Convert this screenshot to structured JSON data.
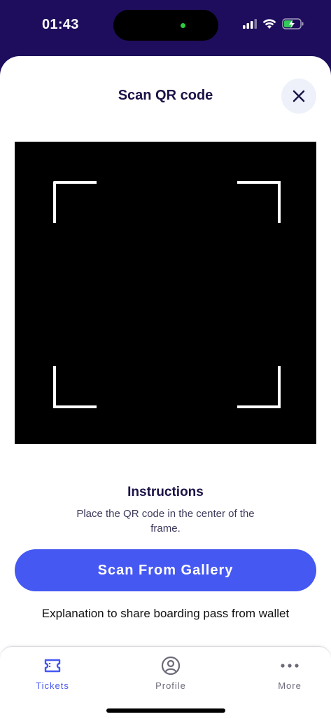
{
  "status_bar": {
    "time": "01:43",
    "icons": [
      "signal-icon",
      "wifi-icon",
      "battery-charging-icon"
    ]
  },
  "header": {
    "title": "Scan QR code",
    "close_icon": "close-icon"
  },
  "scanner": {
    "frame_icon": "scan-frame"
  },
  "instructions": {
    "title": "Instructions",
    "text": "Place the QR code in the center of the frame."
  },
  "actions": {
    "scan_gallery_label": "Scan From Gallery",
    "explanation_link": "Explanation to share boarding pass from wallet"
  },
  "tabs": [
    {
      "label": "Tickets",
      "icon": "ticket-icon",
      "active": true
    },
    {
      "label": "Profile",
      "icon": "profile-icon",
      "active": false
    },
    {
      "label": "More",
      "icon": "more-icon",
      "active": false
    }
  ],
  "colors": {
    "header_bg": "#1e0d5c",
    "primary": "#4658f2",
    "title_text": "#1a1346",
    "tab_active": "#4658f2",
    "tab_inactive": "#6b6a7a"
  }
}
